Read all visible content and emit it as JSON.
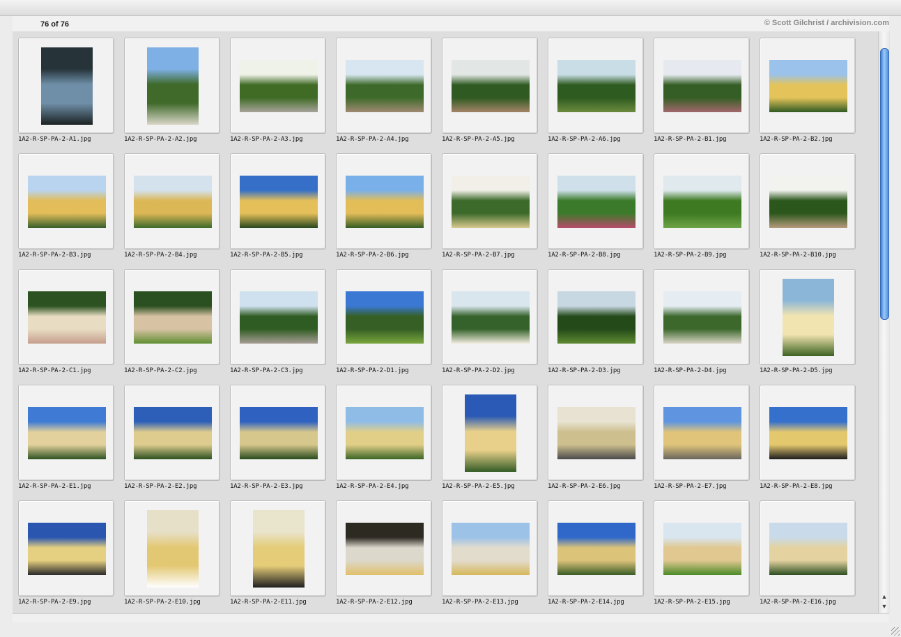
{
  "header": {
    "count_text": "76 of 76",
    "copyright": "© Scott Gilchrist / archivision.com"
  },
  "thumbnails": [
    {
      "file": "1A2-R-SP-PA-2-A1.jpg",
      "orient": "portrait",
      "colors": [
        "#26343a",
        "#6f8fa8",
        "#1b2222"
      ]
    },
    {
      "file": "1A2-R-SP-PA-2-A2.jpg",
      "orient": "portrait",
      "colors": [
        "#7eb0e6",
        "#3f6a2a",
        "#d9d6c8"
      ]
    },
    {
      "file": "1A2-R-SP-PA-2-A3.jpg",
      "orient": "landscape",
      "colors": [
        "#eef2e8",
        "#3f6b25",
        "#a7a39a"
      ]
    },
    {
      "file": "1A2-R-SP-PA-2-A4.jpg",
      "orient": "landscape",
      "colors": [
        "#d7e6f0",
        "#3d6a2a",
        "#a08a72"
      ]
    },
    {
      "file": "1A2-R-SP-PA-2-A5.jpg",
      "orient": "landscape",
      "colors": [
        "#e2e7e5",
        "#2f5a22",
        "#a38467"
      ]
    },
    {
      "file": "1A2-R-SP-PA-2-A6.jpg",
      "orient": "landscape",
      "colors": [
        "#c8dde6",
        "#2e5b1f",
        "#6b8a3e"
      ]
    },
    {
      "file": "1A2-R-SP-PA-2-B1.jpg",
      "orient": "landscape",
      "colors": [
        "#e6eaf0",
        "#345e25",
        "#a3676c"
      ]
    },
    {
      "file": "1A2-R-SP-PA-2-B2.jpg",
      "orient": "landscape",
      "colors": [
        "#9bc2ea",
        "#e4c45a",
        "#2f5a22"
      ]
    },
    {
      "file": "1A2-R-SP-PA-2-B3.jpg",
      "orient": "landscape",
      "colors": [
        "#b9d4ee",
        "#e2bd5a",
        "#375f2a"
      ]
    },
    {
      "file": "1A2-R-SP-PA-2-B4.jpg",
      "orient": "landscape",
      "colors": [
        "#d4e2ee",
        "#dcb756",
        "#3d6a2a"
      ]
    },
    {
      "file": "1A2-R-SP-PA-2-B5.jpg",
      "orient": "landscape",
      "colors": [
        "#356fc8",
        "#e5c05a",
        "#28471d"
      ]
    },
    {
      "file": "1A2-R-SP-PA-2-B6.jpg",
      "orient": "landscape",
      "colors": [
        "#7ab0ea",
        "#e3bd58",
        "#345d25"
      ]
    },
    {
      "file": "1A2-R-SP-PA-2-B7.jpg",
      "orient": "landscape",
      "colors": [
        "#f1efe7",
        "#3c6a2a",
        "#d9c88e"
      ]
    },
    {
      "file": "1A2-R-SP-PA-2-B8.jpg",
      "orient": "landscape",
      "colors": [
        "#cfe0ea",
        "#3b7a2a",
        "#b74c6a"
      ]
    },
    {
      "file": "1A2-R-SP-PA-2-B9.jpg",
      "orient": "landscape",
      "colors": [
        "#dfe9ee",
        "#3e7a22",
        "#6ea446"
      ]
    },
    {
      "file": "1A2-R-SP-PA-2-B10.jpg",
      "orient": "landscape",
      "colors": [
        "#f2f2ee",
        "#2b571c",
        "#b69a7c"
      ]
    },
    {
      "file": "1A2-R-SP-PA-2-C1.jpg",
      "orient": "landscape",
      "colors": [
        "#2c5222",
        "#e8dcc2",
        "#c59d8c"
      ]
    },
    {
      "file": "1A2-R-SP-PA-2-C2.jpg",
      "orient": "landscape",
      "colors": [
        "#2a4f20",
        "#d8c2a4",
        "#5f8f32"
      ]
    },
    {
      "file": "1A2-R-SP-PA-2-C3.jpg",
      "orient": "landscape",
      "colors": [
        "#cfe1ee",
        "#2f5c22",
        "#a79d94"
      ]
    },
    {
      "file": "1A2-R-SP-PA-2-D1.jpg",
      "orient": "landscape",
      "colors": [
        "#3a78d4",
        "#355f25",
        "#7aa63d"
      ]
    },
    {
      "file": "1A2-R-SP-PA-2-D2.jpg",
      "orient": "landscape",
      "colors": [
        "#d9e6ee",
        "#35622a",
        "#f0ecde"
      ]
    },
    {
      "file": "1A2-R-SP-PA-2-D3.jpg",
      "orient": "landscape",
      "colors": [
        "#c8d8e2",
        "#244a1a",
        "#5e8a30"
      ]
    },
    {
      "file": "1A2-R-SP-PA-2-D4.jpg",
      "orient": "landscape",
      "colors": [
        "#e6edf2",
        "#3c682c",
        "#d9d4c6"
      ]
    },
    {
      "file": "1A2-R-SP-PA-2-D5.jpg",
      "orient": "portrait",
      "colors": [
        "#8bb6d8",
        "#f2e4b0",
        "#3b6222"
      ]
    },
    {
      "file": "1A2-R-SP-PA-2-E1.jpg",
      "orient": "landscape",
      "colors": [
        "#3f7ad4",
        "#e2d19c",
        "#2e5322"
      ]
    },
    {
      "file": "1A2-R-SP-PA-2-E2.jpg",
      "orient": "landscape",
      "colors": [
        "#2d5fb8",
        "#ddcc8e",
        "#2c5020"
      ]
    },
    {
      "file": "1A2-R-SP-PA-2-E3.jpg",
      "orient": "landscape",
      "colors": [
        "#2f62c0",
        "#d6c78c",
        "#284a1c"
      ]
    },
    {
      "file": "1A2-R-SP-PA-2-E4.jpg",
      "orient": "landscape",
      "colors": [
        "#8fbce6",
        "#e1cf88",
        "#3b6425"
      ]
    },
    {
      "file": "1A2-R-SP-PA-2-E5.jpg",
      "orient": "portrait",
      "colors": [
        "#2a5ab5",
        "#e8d08a",
        "#345c26"
      ]
    },
    {
      "file": "1A2-R-SP-PA-2-E6.jpg",
      "orient": "landscape",
      "colors": [
        "#e7e2d2",
        "#cdbf8e",
        "#4a4a4a"
      ]
    },
    {
      "file": "1A2-R-SP-PA-2-E7.jpg",
      "orient": "landscape",
      "colors": [
        "#5f95e0",
        "#dfc47a",
        "#6a665e"
      ]
    },
    {
      "file": "1A2-R-SP-PA-2-E8.jpg",
      "orient": "landscape",
      "colors": [
        "#3570cc",
        "#e4c86e",
        "#1c1c1c"
      ]
    },
    {
      "file": "1A2-R-SP-PA-2-E9.jpg",
      "orient": "landscape",
      "colors": [
        "#2a56b0",
        "#e5cf80",
        "#2a2a2a"
      ]
    },
    {
      "file": "1A2-R-SP-PA-2-E10.jpg",
      "orient": "portrait",
      "colors": [
        "#e6e0c8",
        "#e3c874",
        "#ffffff"
      ]
    },
    {
      "file": "1A2-R-SP-PA-2-E11.jpg",
      "orient": "portrait",
      "colors": [
        "#e9e4cc",
        "#e4cc78",
        "#1f1f1f"
      ]
    },
    {
      "file": "1A2-R-SP-PA-2-E12.jpg",
      "orient": "landscape",
      "colors": [
        "#2d2a22",
        "#dcd8cc",
        "#e0c06a"
      ]
    },
    {
      "file": "1A2-R-SP-PA-2-E13.jpg",
      "orient": "landscape",
      "colors": [
        "#9cc2e8",
        "#e2dccd",
        "#d7b85a"
      ]
    },
    {
      "file": "1A2-R-SP-PA-2-E14.jpg",
      "orient": "landscape",
      "colors": [
        "#2f68c8",
        "#dcc37a",
        "#3a5d26"
      ]
    },
    {
      "file": "1A2-R-SP-PA-2-E15.jpg",
      "orient": "landscape",
      "colors": [
        "#d9e6f0",
        "#e0c890",
        "#4b8a28"
      ]
    },
    {
      "file": "1A2-R-SP-PA-2-E16.jpg",
      "orient": "landscape",
      "colors": [
        "#c9dbeb",
        "#e4d2a0",
        "#2d4f22"
      ]
    }
  ],
  "scroll": {
    "position": 0,
    "visible_fraction": 0.53
  }
}
